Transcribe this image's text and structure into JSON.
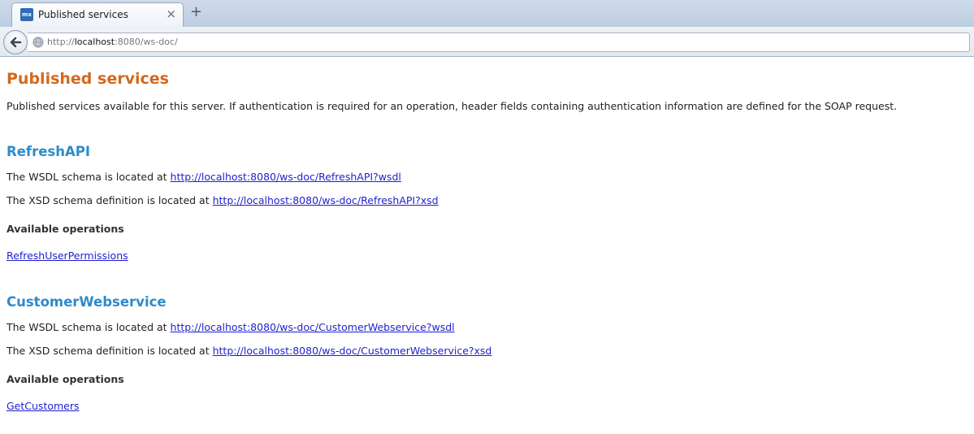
{
  "browser": {
    "tab_title": "Published services",
    "favicon_text": "mx",
    "close_glyph": "×",
    "new_tab_glyph": "+",
    "url_prefix": "http://",
    "url_host": "localhost",
    "url_rest": ":8080/ws-doc/"
  },
  "page": {
    "title": "Published services",
    "intro": "Published services available for this server. If authentication is required for an operation, header fields containing authentication information are defined for the SOAP request."
  },
  "services": [
    {
      "name": "RefreshAPI",
      "wsdl_prefix": "The WSDL schema is located at",
      "wsdl_link": "http://localhost:8080/ws-doc/RefreshAPI?wsdl",
      "xsd_prefix": "The XSD schema definition is located at",
      "xsd_link": "http://localhost:8080/ws-doc/RefreshAPI?xsd",
      "ops_heading": "Available operations",
      "operations": [
        "RefreshUserPermissions"
      ]
    },
    {
      "name": "CustomerWebservice",
      "wsdl_prefix": "The WSDL schema is located at",
      "wsdl_link": "http://localhost:8080/ws-doc/CustomerWebservice?wsdl",
      "xsd_prefix": "The XSD schema definition is located at",
      "xsd_link": "http://localhost:8080/ws-doc/CustomerWebservice?xsd",
      "ops_heading": "Available operations",
      "operations": [
        "GetCustomers"
      ]
    }
  ],
  "colors": {
    "title": "#d2691e",
    "service_title": "#2e8bc9",
    "link": "#1f1fce"
  }
}
